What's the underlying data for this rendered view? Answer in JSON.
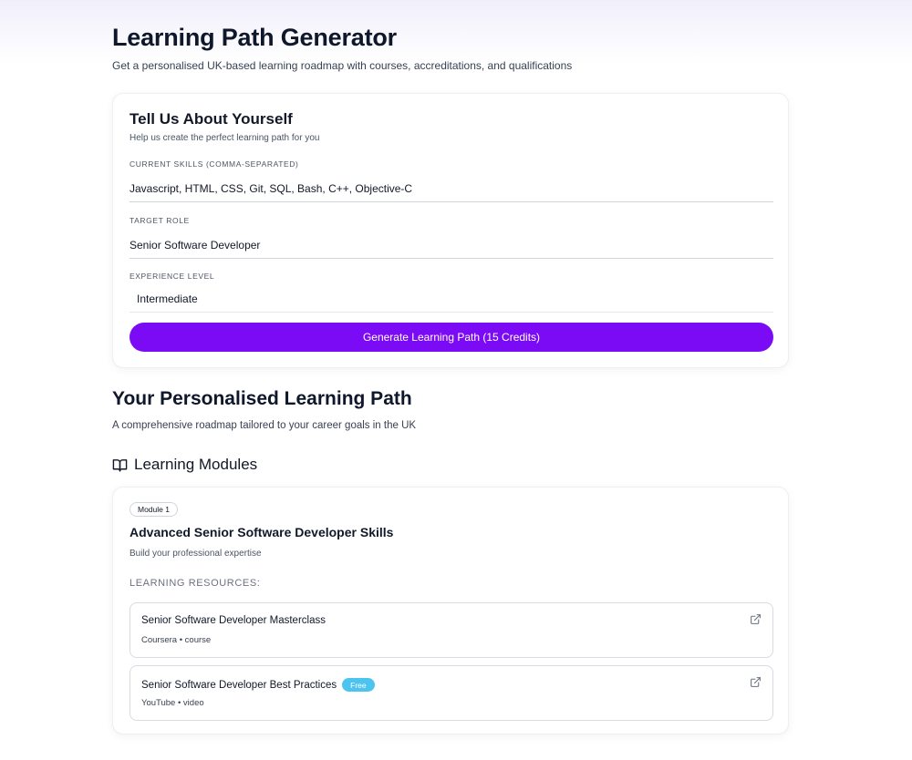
{
  "header": {
    "title": "Learning Path Generator",
    "subtitle": "Get a personalised UK-based learning roadmap with courses, accreditations, and qualifications"
  },
  "form": {
    "title": "Tell Us About Yourself",
    "subtitle": "Help us create the perfect learning path for you",
    "fields": {
      "skills": {
        "label": "Current Skills (Comma-Separated)",
        "value": "Javascript, HTML, CSS, Git, SQL, Bash, C++, Objective-C"
      },
      "role": {
        "label": "Target Role",
        "value": "Senior Software Developer"
      },
      "experience": {
        "label": "Experience Level",
        "value": "Intermediate"
      }
    },
    "submit_label": "Generate Learning Path (15 Credits)",
    "accent_color": "#7c0bf5"
  },
  "results": {
    "title": "Your Personalised Learning Path",
    "subtitle": "A comprehensive roadmap tailored to your career goals in the UK",
    "modules_heading": "Learning Modules",
    "modules_icon": "open-book-icon",
    "module": {
      "badge": "Module 1",
      "title": "Advanced Senior Software Developer Skills",
      "subtitle": "Build your professional expertise",
      "resources_label": "LEARNING RESOURCES:",
      "resources": [
        {
          "title": "Senior Software Developer Masterclass",
          "meta": "Coursera • course",
          "badge": "",
          "icon": "external-link-icon"
        },
        {
          "title": "Senior Software Developer Best Practices",
          "meta": "YouTube • video",
          "badge": "Free",
          "badge_color": "#4dc4ef",
          "icon": "external-link-icon"
        }
      ]
    }
  }
}
